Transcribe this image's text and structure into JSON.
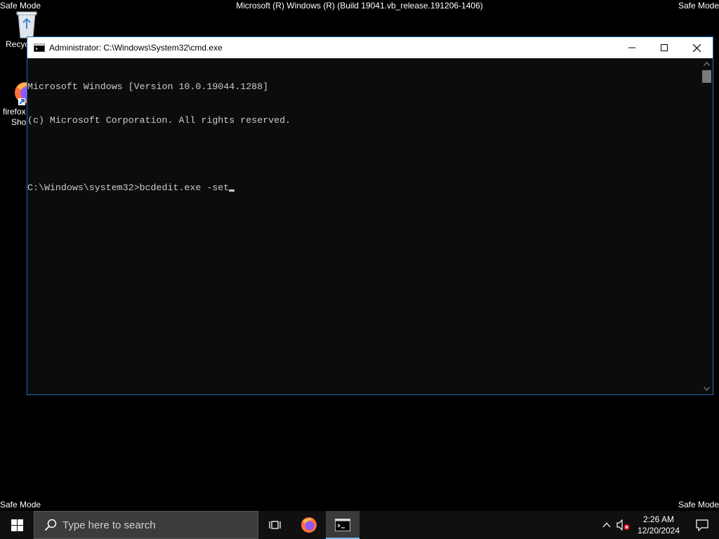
{
  "desktop": {
    "safe_mode_label": "Safe Mode",
    "build_text": "Microsoft (R) Windows (R) (Build 19041.vb_release.191206-1406)",
    "icons": [
      {
        "name": "recycle-bin",
        "label": "Recyc"
      },
      {
        "name": "firefox-shortcut",
        "label_line1": "firefox",
        "label_line2": "Shor"
      }
    ]
  },
  "cmd_window": {
    "title": "Administrator: C:\\Windows\\System32\\cmd.exe",
    "lines": [
      "Microsoft Windows [Version 10.0.19044.1288]",
      "(c) Microsoft Corporation. All rights reserved.",
      "",
      "C:\\Windows\\system32>bcdedit.exe -set"
    ]
  },
  "taskbar": {
    "search_placeholder": "Type here to search",
    "clock_time": "2:26 AM",
    "clock_date": "12/20/2024",
    "accent": "#76b9ed"
  }
}
